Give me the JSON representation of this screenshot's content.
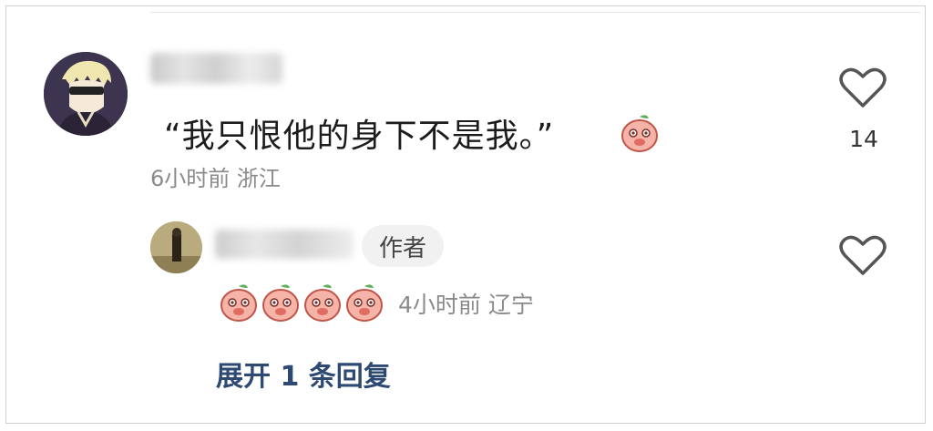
{
  "comment": {
    "avatar_icon": "user-avatar",
    "text": "“我只恨他的身下不是我。”",
    "emoji_icon": "peach-face-emoji",
    "time_location": "6小时前  浙江",
    "like_count": "14",
    "like_icon": "heart-outline-icon"
  },
  "reply": {
    "avatar_icon": "user-avatar",
    "author_badge": "作者",
    "emoji_icons": [
      "peach-face-emoji",
      "peach-face-emoji",
      "peach-face-emoji",
      "peach-face-emoji"
    ],
    "time_location": "4小时前  辽宁",
    "like_icon": "heart-outline-icon"
  },
  "expand_replies": "展开 1 条回复",
  "colors": {
    "link": "#2e4a73",
    "meta_text": "#8a8a8a",
    "badge_bg": "#f1f1f1"
  }
}
